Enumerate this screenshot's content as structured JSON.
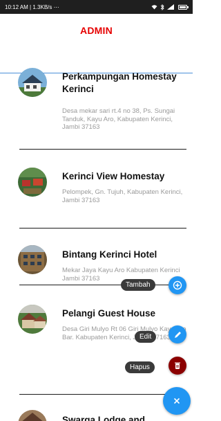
{
  "status_bar": {
    "time": "10:12 AM",
    "speed": "1.3KB/s",
    "extra": "⋯"
  },
  "appbar": {
    "title": "ADMIN"
  },
  "items": [
    {
      "name": "Perkampungan Homestay Kerinci",
      "address": "Desa mekar sari rt.4 no 38, Ps. Sungai Tanduk, Kayu Aro, Kabupaten Kerinci, Jambi 37163"
    },
    {
      "name": "Kerinci View Homestay",
      "address": "Pelompek, Gn. Tujuh, Kabupaten Kerinci, Jambi 37163"
    },
    {
      "name": "Bintang Kerinci Hotel",
      "address": "Mekar Jaya Kayu Aro Kabupaten Kerinci Jambi 37163"
    },
    {
      "name": "Pelangi Guest House",
      "address": "Desa Giri Mulyo Rt 06 Giri Mulyo Kayu Aro Bar. Kabupaten Kerinci, Jambi 37163"
    },
    {
      "name": "Swarga Lodge and",
      "address": ""
    }
  ],
  "fab_menu": {
    "add_label": "Tambah",
    "edit_label": "Edit",
    "delete_label": "Hapus",
    "add_icon": "plus-circle-icon",
    "edit_icon": "pencil-icon",
    "delete_icon": "trash-icon",
    "close_icon": "close-icon"
  },
  "colors": {
    "title": "#e60000",
    "divider_accent": "#4a8fd9",
    "fab_blue": "#2196f3",
    "fab_red": "#8b0000"
  }
}
